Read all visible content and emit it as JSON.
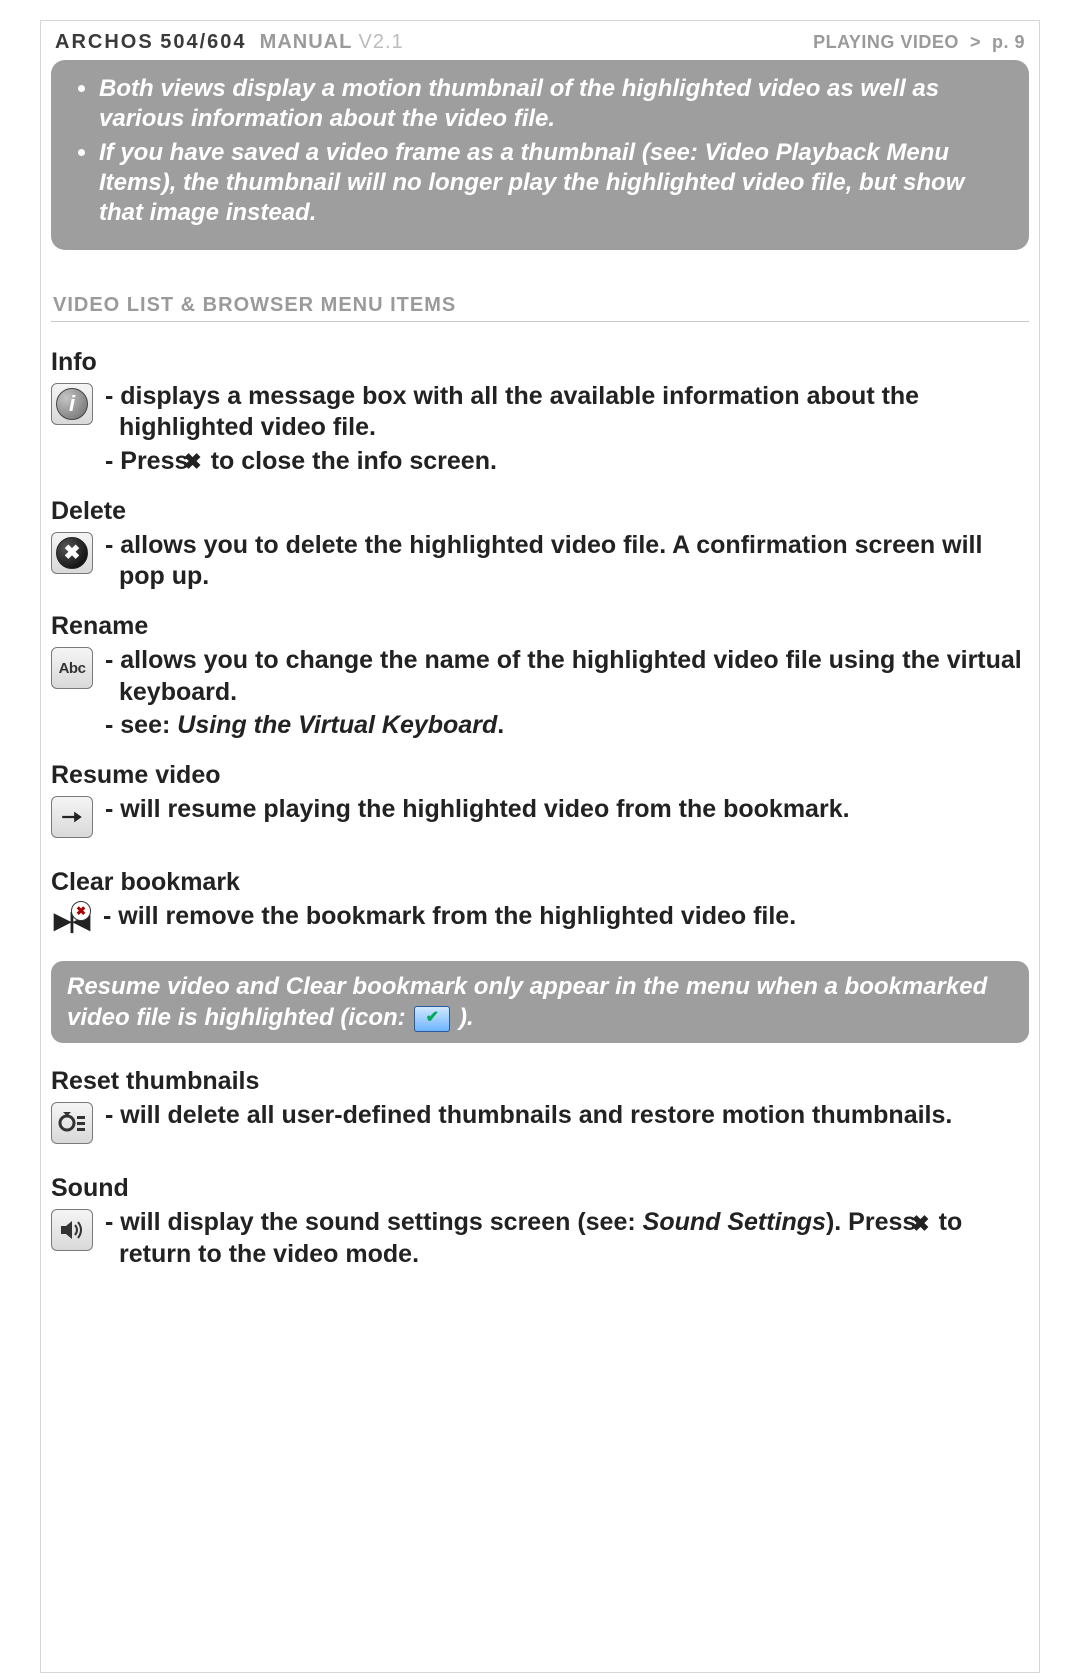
{
  "header": {
    "brand": "ARCHOS",
    "model": "504/604",
    "manual": "MANUAL",
    "version": "V2.1",
    "section": "PLAYING VIDEO",
    "chevron": ">",
    "page": "p. 9"
  },
  "top_note": {
    "bullets": [
      "Both views display a motion thumbnail of the highlighted video as well as various information about the video file.",
      "If you have saved a video frame as a thumbnail (see: Video Playback Menu Items), the thumbnail will no longer play the highlighted video file, but show that image instead."
    ]
  },
  "section_heading": "Video List & Browser Menu Items",
  "items": {
    "info": {
      "title": "Info",
      "line1": "- displays a message box with all the available information about the highlighted video file.",
      "line2_pre": "- Press ",
      "line2_post": " to close the info screen."
    },
    "delete": {
      "title": "Delete",
      "line1": "- allows you to delete the highlighted video file. A confirmation screen will pop up."
    },
    "rename": {
      "title": "Rename",
      "line1": "- allows you to change the name of the highlighted video file using the virtual keyboard.",
      "line2_pre": "- see: ",
      "line2_ital": "Using the Virtual Keyboard",
      "line2_post": "."
    },
    "resume": {
      "title": "Resume video",
      "line1": "- will resume playing the highlighted video from the bookmark."
    },
    "clear_bm": {
      "title": "Clear bookmark",
      "line1": "- will remove the bookmark from the highlighted video file."
    },
    "reset_thumb": {
      "title": "Reset thumbnails",
      "line1": "- will delete all user-defined thumbnails and restore motion thumbnails."
    },
    "sound": {
      "title": "Sound",
      "line1_pre": "- will display the sound settings screen (see: ",
      "line1_ital": "Sound Settings",
      "line1_mid": "). Press ",
      "line1_post": " to return to the video mode."
    }
  },
  "mid_note": {
    "text_pre": "Resume video and Clear bookmark only appear in the menu when a bookmarked video file is highlighted (icon: ",
    "text_post": ")."
  },
  "glyphs": {
    "x": "✖",
    "info_i": "i",
    "del_x": "✖",
    "abc": "Abc",
    "check": "✔",
    "clear_base": "▶|◀",
    "clear_badge": "✖"
  }
}
